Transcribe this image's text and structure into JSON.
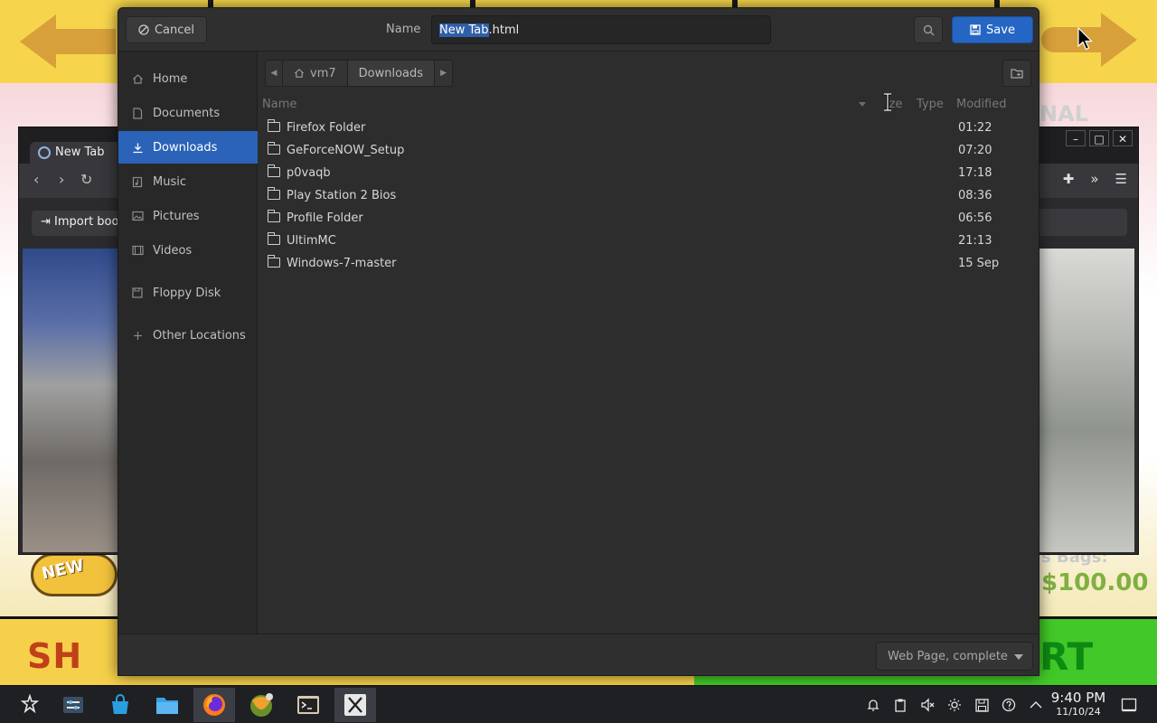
{
  "background": {
    "new_badge": "NEW",
    "banner": "NAL",
    "price_top": "s Bags:",
    "price": "$100.00",
    "shop": "SH",
    "start": "RT"
  },
  "browser": {
    "tab_title": "New Tab",
    "import_label": "Import boo"
  },
  "dialog": {
    "cancel_label": "Cancel",
    "name_label": "Name",
    "filename_selected": "New Tab",
    "filename_ext": ".html",
    "save_label": "Save",
    "sidebar": [
      {
        "label": "Home",
        "icon": "home-icon"
      },
      {
        "label": "Documents",
        "icon": "document-icon"
      },
      {
        "label": "Downloads",
        "icon": "download-icon",
        "active": true
      },
      {
        "label": "Music",
        "icon": "music-icon"
      },
      {
        "label": "Pictures",
        "icon": "picture-icon"
      },
      {
        "label": "Videos",
        "icon": "video-icon"
      },
      {
        "label": "Floppy Disk",
        "icon": "floppy-icon"
      },
      {
        "label": "Other Locations",
        "icon": "plus-icon"
      }
    ],
    "path": {
      "home": "vm7",
      "current": "Downloads"
    },
    "columns": {
      "name": "Name",
      "size": "ize",
      "type": "Type",
      "modified": "Modified"
    },
    "files": [
      {
        "name": "Firefox Folder",
        "modified": "01:22"
      },
      {
        "name": "GeForceNOW_Setup",
        "modified": "07:20"
      },
      {
        "name": "p0vaqb",
        "modified": "17:18"
      },
      {
        "name": "Play Station 2 Bios",
        "modified": "08:36"
      },
      {
        "name": "Profile Folder",
        "modified": "06:56"
      },
      {
        "name": "UltimMC",
        "modified": "21:13"
      },
      {
        "name": "Windows-7-master",
        "modified": "15 Sep"
      }
    ],
    "filetype": "Web Page, complete"
  },
  "taskbar": {
    "apps": [
      "app-launcher-icon",
      "settings-icon",
      "store-icon",
      "files-icon",
      "firefox-icon",
      "geforce-icon",
      "terminal-icon",
      "x-app-icon"
    ],
    "clock_time": "9:40 PM",
    "clock_date": "11/10/24"
  },
  "colors": {
    "accent": "#2a63b8",
    "save_button": "#2566c4",
    "dialog_bg": "#2d2d2d",
    "taskbar_bg": "#1f2023"
  }
}
